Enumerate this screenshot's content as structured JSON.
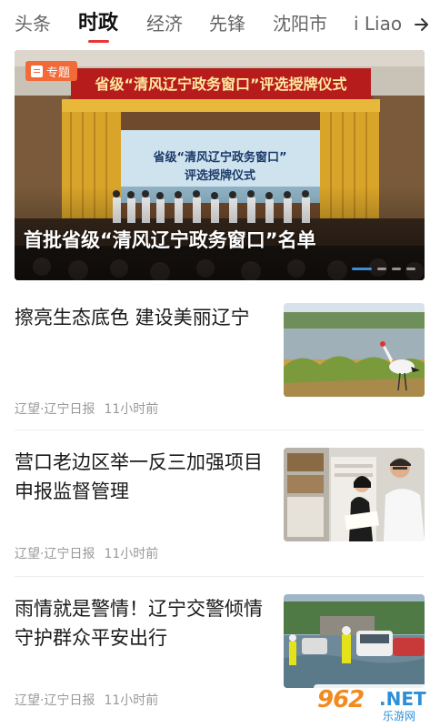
{
  "tabs": [
    {
      "label": "头条",
      "active": false
    },
    {
      "label": "时政",
      "active": true
    },
    {
      "label": "经济",
      "active": false
    },
    {
      "label": "先锋",
      "active": false
    },
    {
      "label": "沈阳市",
      "active": false
    },
    {
      "label": "i Liao",
      "active": false
    }
  ],
  "tab_more_icon": "arrow-right-icon",
  "banner": {
    "badge_label": "专题",
    "badge_icon": "document-icon",
    "title": "首批省级“清风辽宁政务窗口”名单",
    "image_text": {
      "stage_banner": "省级“清风辽宁政务窗口”评选授牌仪式",
      "screen_line1": "省级“清风辽宁政务窗口”",
      "screen_line2": "评选授牌仪式"
    },
    "carousel_pages": 4,
    "carousel_active": 1
  },
  "news": [
    {
      "title": "擦亮生态底色 建设美丽辽宁",
      "source": "辽望·辽宁日报",
      "time": "11小时前"
    },
    {
      "title": "营口老边区举一反三加强项目申报监督管理",
      "source": "辽望·辽宁日报",
      "time": "11小时前"
    },
    {
      "title": "雨情就是警情！辽宁交警倾情守护群众平安出行",
      "source": "辽望·辽宁日报",
      "time": "11小时前"
    }
  ],
  "watermark": {
    "number": "962",
    "suffix": ".NET",
    "sub": "乐游网"
  },
  "colors": {
    "accent": "#e33333",
    "badge": "#f26a38",
    "meta": "#999999",
    "carousel_active": "#3a8ddc"
  }
}
